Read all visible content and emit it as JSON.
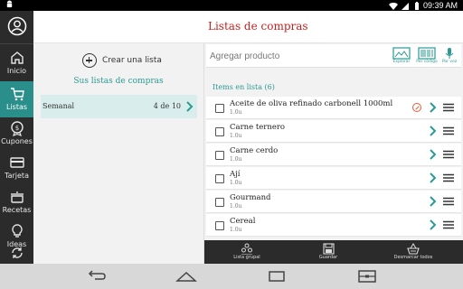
{
  "status_bar": {
    "left_icon": "android-icon",
    "icons": [
      "wifi-icon",
      "signal-icon",
      "battery-icon"
    ],
    "time": "09:39 AM"
  },
  "rail": {
    "items": [
      {
        "label": "Inicio",
        "icon": "home-icon"
      },
      {
        "label": "Listas",
        "icon": "shopping-cart-icon"
      },
      {
        "label": "Cupones",
        "icon": "coupon-icon"
      },
      {
        "label": "Tarjeta",
        "icon": "card-icon"
      },
      {
        "label": "Recetas",
        "icon": "cooking-pot-icon"
      },
      {
        "label": "Ideas",
        "icon": "lightbulb-icon"
      }
    ]
  },
  "header": {
    "title": "Listas de compras"
  },
  "lists_panel": {
    "create_label": "Crear una lista",
    "heading": "Sus listas de compras",
    "lists": [
      {
        "name": "Semanal",
        "count": "4 de 10"
      }
    ]
  },
  "search": {
    "placeholder": "Agregar producto",
    "tools": [
      {
        "label": "Explorar",
        "icon": "explore-icon"
      },
      {
        "label": "Por código",
        "icon": "barcode-icon"
      },
      {
        "label": "Por voz",
        "icon": "microphone-icon"
      }
    ]
  },
  "items_panel": {
    "heading": "Items en lista (6)",
    "items": [
      {
        "name": "Aceite de oliva refinado carbonell 1000ml",
        "qty": "1.0u",
        "promo": true
      },
      {
        "name": "Carne ternero",
        "qty": "1.0u",
        "promo": false
      },
      {
        "name": "Carne cerdo",
        "qty": "1.0u",
        "promo": false
      },
      {
        "name": "Ají",
        "qty": "1.0u",
        "promo": false
      },
      {
        "name": "Gourmand",
        "qty": "1.0u",
        "promo": false
      },
      {
        "name": "Cereal",
        "qty": "1.0u",
        "promo": false
      }
    ]
  },
  "bottom_bar": {
    "buttons": [
      {
        "label": "Lista grupal",
        "icon": "group-icon"
      },
      {
        "label": "Guardar",
        "icon": "save-icon"
      },
      {
        "label": "Desmarcar todos",
        "icon": "uncheck-basket-icon"
      }
    ]
  },
  "colors": {
    "accent": "#2a9a93",
    "title": "#c8201f",
    "rail": "#2b2b2b",
    "selected_row": "#d9eeec"
  }
}
